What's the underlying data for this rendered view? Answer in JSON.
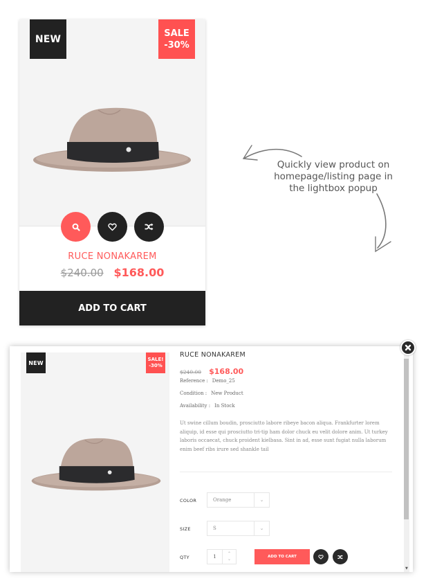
{
  "card": {
    "badge_new": "NEW",
    "badge_sale_line1": "SALE",
    "badge_sale_line2": "-30%",
    "product_name": "RUCE NONAKAREM",
    "old_price": "$240.00",
    "new_price": "$168.00",
    "add_to_cart": "ADD TO CART",
    "actions": [
      "search-icon",
      "heart-icon",
      "shuffle-icon"
    ]
  },
  "annotation": {
    "line1": "Quickly view product on",
    "line2": "homepage/listing page in",
    "line3": "the lightbox popup"
  },
  "popup": {
    "badge_new": "NEW",
    "badge_sale_line1": "SALE!",
    "badge_sale_line2": "-30%",
    "title": "RUCE NONAKAREM",
    "old_price": "$240.00",
    "new_price": "$168.00",
    "reference_label": "Reference :",
    "reference_value": "Demo_25",
    "condition_label": "Condition :",
    "condition_value": "New Product",
    "availability_label": "Availability :",
    "availability_value": "In Stock",
    "description": "Ut swine cillum boudin, prosciutto labore ribeye bacon aliqua. Frankfurter lorem aliquip, id esse qui prosciutto tri-tip ham dolor chuck eu velit dolore anim. Ut turkey laboris occaecat, chuck proident kielbasa. Sint in ad, esse sunt fugiat nulla laborum enim beef ribs irure sed shankle tail",
    "color_label": "COLOR",
    "color_value": "Orange",
    "size_label": "SIZE",
    "size_value": "S",
    "qty_label": "QTY",
    "qty_value": "1",
    "add_to_cart": "ADD TO CART"
  },
  "colors": {
    "accent": "#ff5a5a",
    "dark": "#222222",
    "image_bg": "#f4f4f4"
  }
}
